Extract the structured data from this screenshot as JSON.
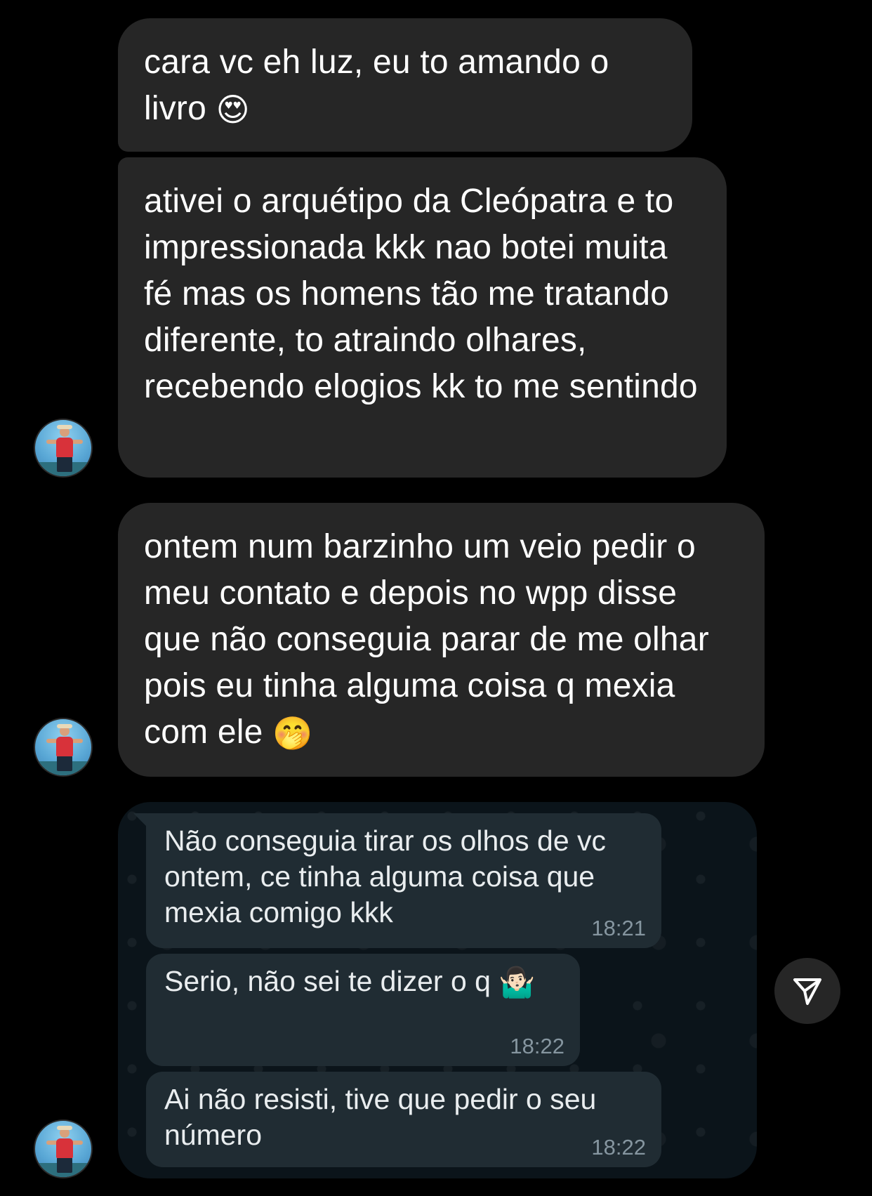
{
  "thread": {
    "messages": [
      {
        "text": "cara vc eh luz, eu to amando o livro",
        "emoji": "😍"
      },
      {
        "text": "ativei o arquétipo da Cleópatra e to impressionada kkk nao botei muita fé mas os homens tão me tratando diferente, to atraindo olhares, recebendo elogios kk to me sentindo"
      },
      {
        "text": "ontem num barzinho um veio pedir o meu contato e depois no wpp disse que não conseguia parar de me olhar pois eu tinha alguma coisa q mexia com ele",
        "emoji": "🤭"
      }
    ],
    "avatar_icon": "user-avatar-photo"
  },
  "shared_screenshot": {
    "messages": [
      {
        "text": "Não conseguia tirar os olhos de vc ontem, ce tinha alguma coisa que mexia comigo kkk",
        "time": "18:21"
      },
      {
        "text": "Serio, não sei te dizer o q",
        "emoji": "🤷🏻‍♂️",
        "time": "18:22"
      },
      {
        "text": "Ai não resisti, tive que pedir o seu número",
        "time": "18:22"
      }
    ]
  },
  "actions": {
    "send_icon": "paper-plane-icon"
  },
  "colors": {
    "background": "#000000",
    "bubble": "#262626",
    "wa_background": "#0b141a",
    "wa_bubble": "#202c33",
    "wa_time": "#8696a0"
  }
}
